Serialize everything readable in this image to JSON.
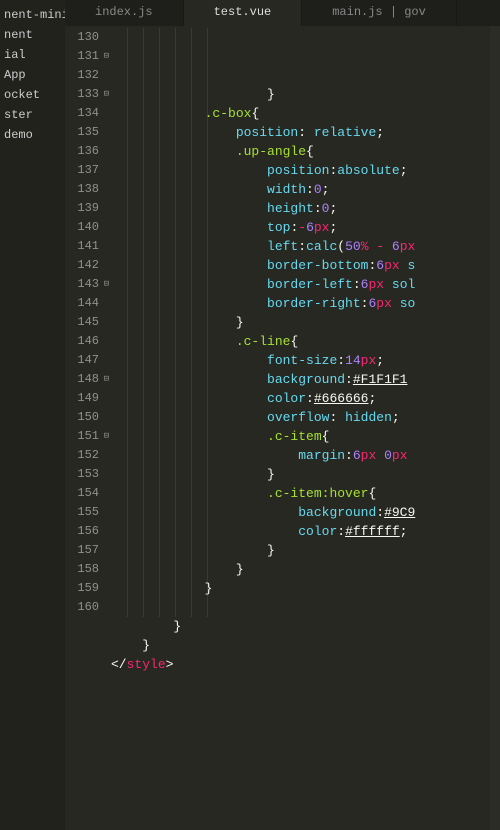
{
  "sidebar": {
    "items": [
      {
        "label": "nent-mini"
      },
      {
        "label": "nent"
      },
      {
        "label": "ial"
      },
      {
        "label": "App"
      },
      {
        "label": "ocket"
      },
      {
        "label": "ster"
      },
      {
        "label": "demo"
      }
    ]
  },
  "tabs": [
    {
      "label": "index.js",
      "active": false
    },
    {
      "label": "test.vue",
      "active": true
    },
    {
      "label": "main.js | gov",
      "active": false
    }
  ],
  "gutter": {
    "start": 130,
    "end": 160,
    "fold_rows": [
      131,
      133,
      143,
      148,
      151
    ]
  },
  "code_lines": [
    {
      "indent": 10,
      "tokens": [
        {
          "t": "}",
          "c": "s-punc"
        }
      ]
    },
    {
      "indent": 6,
      "tokens": [
        {
          "t": ".c-box",
          "c": "s-sel"
        },
        {
          "t": "{",
          "c": "s-punc"
        }
      ]
    },
    {
      "indent": 8,
      "tokens": [
        {
          "t": "position",
          "c": "s-prop"
        },
        {
          "t": ": ",
          "c": "s-punc"
        },
        {
          "t": "relative",
          "c": "s-val"
        },
        {
          "t": ";",
          "c": "s-punc"
        }
      ]
    },
    {
      "indent": 8,
      "tokens": [
        {
          "t": ".up-angle",
          "c": "s-sel"
        },
        {
          "t": "{",
          "c": "s-punc"
        }
      ]
    },
    {
      "indent": 10,
      "tokens": [
        {
          "t": "position",
          "c": "s-prop"
        },
        {
          "t": ":",
          "c": "s-punc"
        },
        {
          "t": "absolute",
          "c": "s-val"
        },
        {
          "t": ";",
          "c": "s-punc"
        }
      ]
    },
    {
      "indent": 10,
      "tokens": [
        {
          "t": "width",
          "c": "s-prop"
        },
        {
          "t": ":",
          "c": "s-punc"
        },
        {
          "t": "0",
          "c": "s-num"
        },
        {
          "t": ";",
          "c": "s-punc"
        }
      ]
    },
    {
      "indent": 10,
      "tokens": [
        {
          "t": "height",
          "c": "s-prop"
        },
        {
          "t": ":",
          "c": "s-punc"
        },
        {
          "t": "0",
          "c": "s-num"
        },
        {
          "t": ";",
          "c": "s-punc"
        }
      ]
    },
    {
      "indent": 10,
      "tokens": [
        {
          "t": "top",
          "c": "s-prop"
        },
        {
          "t": ":",
          "c": "s-punc"
        },
        {
          "t": "-",
          "c": "s-op"
        },
        {
          "t": "6",
          "c": "s-num"
        },
        {
          "t": "px",
          "c": "s-unit"
        },
        {
          "t": ";",
          "c": "s-punc"
        }
      ]
    },
    {
      "indent": 10,
      "tokens": [
        {
          "t": "left",
          "c": "s-prop"
        },
        {
          "t": ":",
          "c": "s-punc"
        },
        {
          "t": "calc",
          "c": "s-fn"
        },
        {
          "t": "(",
          "c": "s-punc"
        },
        {
          "t": "50",
          "c": "s-num"
        },
        {
          "t": "%",
          "c": "s-pct"
        },
        {
          "t": " - ",
          "c": "s-op"
        },
        {
          "t": "6",
          "c": "s-num"
        },
        {
          "t": "px",
          "c": "s-unit"
        }
      ]
    },
    {
      "indent": 10,
      "tokens": [
        {
          "t": "border-bottom",
          "c": "s-prop"
        },
        {
          "t": ":",
          "c": "s-punc"
        },
        {
          "t": "6",
          "c": "s-num"
        },
        {
          "t": "px",
          "c": "s-unit"
        },
        {
          "t": " s",
          "c": "s-val"
        }
      ]
    },
    {
      "indent": 10,
      "tokens": [
        {
          "t": "border-left",
          "c": "s-prop"
        },
        {
          "t": ":",
          "c": "s-punc"
        },
        {
          "t": "6",
          "c": "s-num"
        },
        {
          "t": "px",
          "c": "s-unit"
        },
        {
          "t": " sol",
          "c": "s-val"
        }
      ]
    },
    {
      "indent": 10,
      "tokens": [
        {
          "t": "border-right",
          "c": "s-prop"
        },
        {
          "t": ":",
          "c": "s-punc"
        },
        {
          "t": "6",
          "c": "s-num"
        },
        {
          "t": "px",
          "c": "s-unit"
        },
        {
          "t": " so",
          "c": "s-val"
        }
      ]
    },
    {
      "indent": 8,
      "tokens": [
        {
          "t": "}",
          "c": "s-punc"
        }
      ]
    },
    {
      "indent": 8,
      "tokens": [
        {
          "t": ".c-line",
          "c": "s-sel"
        },
        {
          "t": "{",
          "c": "s-punc"
        }
      ]
    },
    {
      "indent": 10,
      "tokens": [
        {
          "t": "font-size",
          "c": "s-prop"
        },
        {
          "t": ":",
          "c": "s-punc"
        },
        {
          "t": "14",
          "c": "s-num"
        },
        {
          "t": "px",
          "c": "s-unit"
        },
        {
          "t": ";",
          "c": "s-punc"
        }
      ]
    },
    {
      "indent": 10,
      "tokens": [
        {
          "t": "background",
          "c": "s-prop"
        },
        {
          "t": ":",
          "c": "s-punc"
        },
        {
          "t": "#F1F1F1",
          "c": "s-hex"
        }
      ]
    },
    {
      "indent": 10,
      "tokens": [
        {
          "t": "color",
          "c": "s-prop"
        },
        {
          "t": ":",
          "c": "s-punc"
        },
        {
          "t": "#666666",
          "c": "s-hex"
        },
        {
          "t": ";",
          "c": "s-punc"
        }
      ]
    },
    {
      "indent": 10,
      "tokens": [
        {
          "t": "overflow",
          "c": "s-prop"
        },
        {
          "t": ": ",
          "c": "s-punc"
        },
        {
          "t": "hidden",
          "c": "s-val"
        },
        {
          "t": ";",
          "c": "s-punc"
        }
      ]
    },
    {
      "indent": 10,
      "tokens": [
        {
          "t": ".c-item",
          "c": "s-sel"
        },
        {
          "t": "{",
          "c": "s-punc"
        }
      ]
    },
    {
      "indent": 12,
      "tokens": [
        {
          "t": "margin",
          "c": "s-prop"
        },
        {
          "t": ":",
          "c": "s-punc"
        },
        {
          "t": "6",
          "c": "s-num"
        },
        {
          "t": "px",
          "c": "s-unit"
        },
        {
          "t": " ",
          "c": "s-punc"
        },
        {
          "t": "0",
          "c": "s-num"
        },
        {
          "t": "px",
          "c": "s-unit"
        }
      ]
    },
    {
      "indent": 10,
      "tokens": [
        {
          "t": "}",
          "c": "s-punc"
        }
      ]
    },
    {
      "indent": 10,
      "tokens": [
        {
          "t": ".c-item:hover",
          "c": "s-sel"
        },
        {
          "t": "{",
          "c": "s-punc"
        }
      ]
    },
    {
      "indent": 12,
      "tokens": [
        {
          "t": "background",
          "c": "s-prop"
        },
        {
          "t": ":",
          "c": "s-punc"
        },
        {
          "t": "#9C9",
          "c": "s-hex"
        }
      ]
    },
    {
      "indent": 12,
      "tokens": [
        {
          "t": "color",
          "c": "s-prop"
        },
        {
          "t": ":",
          "c": "s-punc"
        },
        {
          "t": "#ffffff",
          "c": "s-hex"
        },
        {
          "t": ";",
          "c": "s-punc"
        }
      ]
    },
    {
      "indent": 10,
      "tokens": [
        {
          "t": "}",
          "c": "s-punc"
        }
      ]
    },
    {
      "indent": 8,
      "tokens": [
        {
          "t": "}",
          "c": "s-punc"
        }
      ]
    },
    {
      "indent": 6,
      "tokens": [
        {
          "t": "}",
          "c": "s-punc"
        }
      ]
    },
    {
      "indent": 0,
      "tokens": []
    },
    {
      "indent": 4,
      "tokens": [
        {
          "t": "}",
          "c": "s-punc"
        }
      ]
    },
    {
      "indent": 2,
      "tokens": [
        {
          "t": "}",
          "c": "s-punc"
        }
      ]
    },
    {
      "indent": 0,
      "tokens": [
        {
          "t": "</",
          "c": "s-punc"
        },
        {
          "t": "style",
          "c": "s-tag"
        },
        {
          "t": ">",
          "c": "s-punc"
        }
      ]
    }
  ]
}
